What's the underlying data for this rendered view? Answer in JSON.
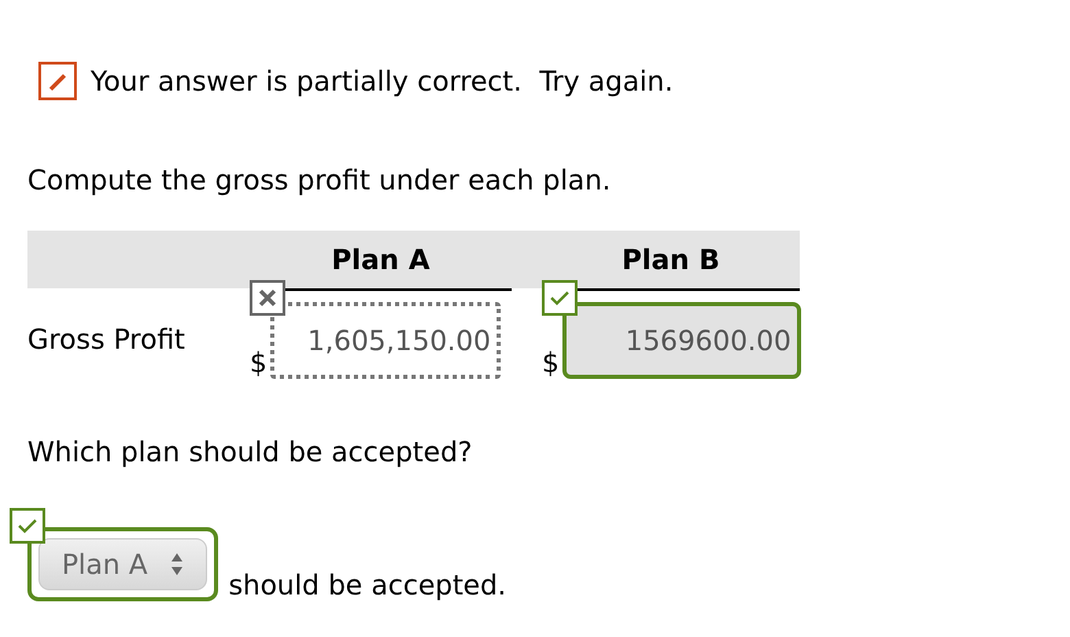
{
  "feedback": {
    "partially_correct": true,
    "message": "Your answer is partially correct.  Try again."
  },
  "question_1": "Compute the gross profit under each plan.",
  "table": {
    "columns": [
      "Plan A",
      "Plan B"
    ],
    "rows": [
      {
        "label": "Gross Profit",
        "cells": [
          {
            "currency": "$",
            "value": "1,605,150.00",
            "correct": false
          },
          {
            "currency": "$",
            "value": "1569600.00",
            "correct": true
          }
        ]
      }
    ]
  },
  "question_2": "Which plan should be accepted?",
  "answer_2": {
    "value": "Plan A",
    "correct": true,
    "suffix": "should be accepted."
  }
}
